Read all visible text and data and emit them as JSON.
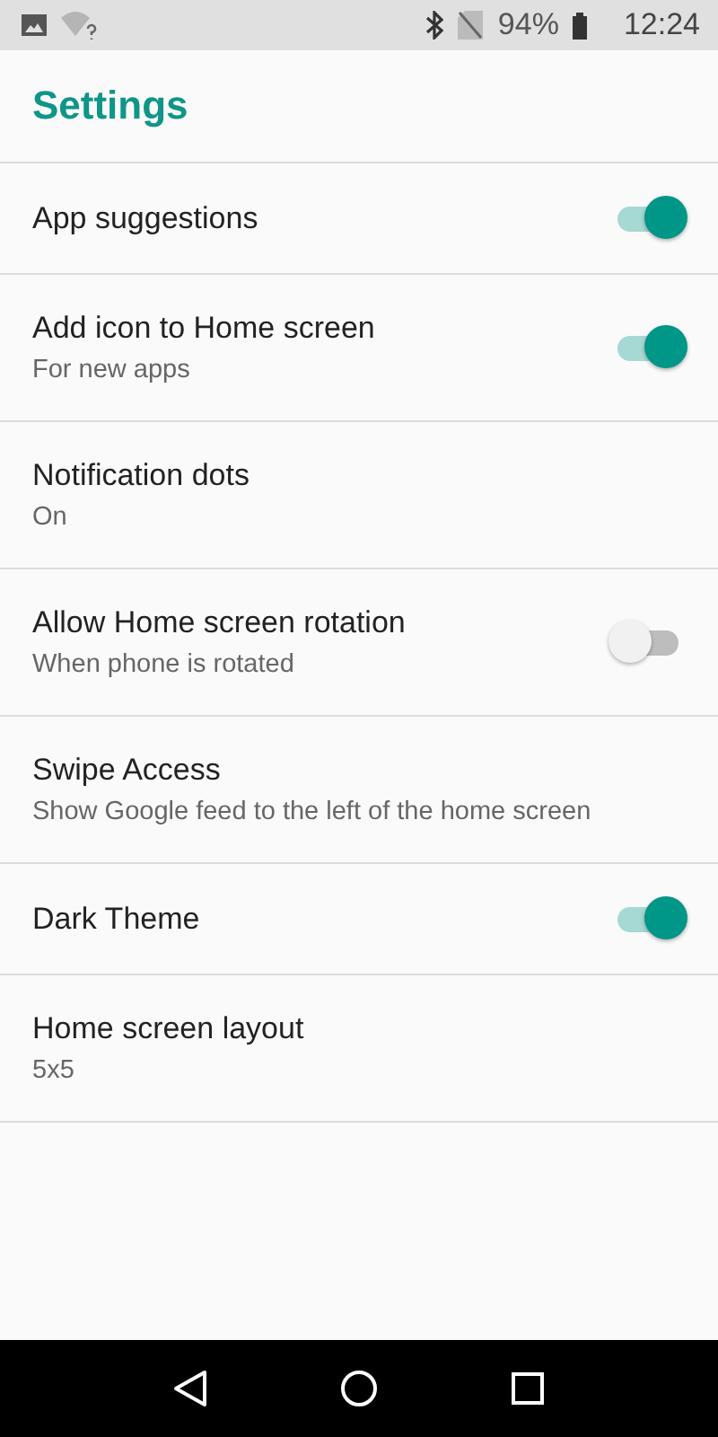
{
  "status_bar": {
    "battery": "94%",
    "time": "12:24"
  },
  "header": {
    "title": "Settings"
  },
  "settings": [
    {
      "title": "App suggestions",
      "kind": "toggle",
      "on": true
    },
    {
      "title": "Add icon to Home screen",
      "subtitle": "For new apps",
      "kind": "toggle",
      "on": true
    },
    {
      "title": "Notification dots",
      "subtitle": "On",
      "kind": "plain"
    },
    {
      "title": "Allow Home screen rotation",
      "subtitle": "When phone is rotated",
      "kind": "toggle",
      "on": false
    },
    {
      "title": "Swipe Access",
      "subtitle": "Show Google feed to the left of the home screen",
      "kind": "plain"
    },
    {
      "title": "Dark Theme",
      "kind": "toggle",
      "on": true
    },
    {
      "title": "Home screen layout",
      "subtitle": "5x5",
      "kind": "plain"
    }
  ]
}
